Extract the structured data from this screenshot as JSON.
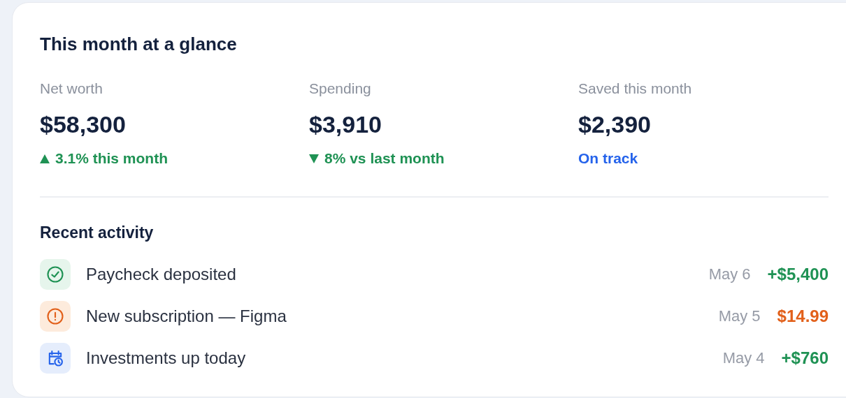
{
  "card": {
    "title": "This month at a glance"
  },
  "stats": [
    {
      "label": "Net worth",
      "value": "$58,300",
      "kind": "up",
      "color": "#1f9254",
      "note": "3.1% this month"
    },
    {
      "label": "Spending",
      "value": "$3,910",
      "kind": "down",
      "color": "#1f9254",
      "note": "8% vs last month"
    },
    {
      "label": "Saved this month",
      "value": "$2,390",
      "kind": "plain",
      "color": "#2563eb",
      "note": "On track"
    }
  ],
  "activity": {
    "title": "Recent activity",
    "items": [
      {
        "kind": "success",
        "text": "Paycheck deposited",
        "date": "May 6",
        "amount": "+$5,400",
        "color": "#1f9254"
      },
      {
        "kind": "warning",
        "text": "New subscription — Figma",
        "date": "May 5",
        "amount": "$14.99",
        "color": "#e2601a"
      },
      {
        "kind": "calendar",
        "text": "Investments up today",
        "date": "May 4",
        "amount": "+$760",
        "color": "#1f9254"
      }
    ]
  }
}
